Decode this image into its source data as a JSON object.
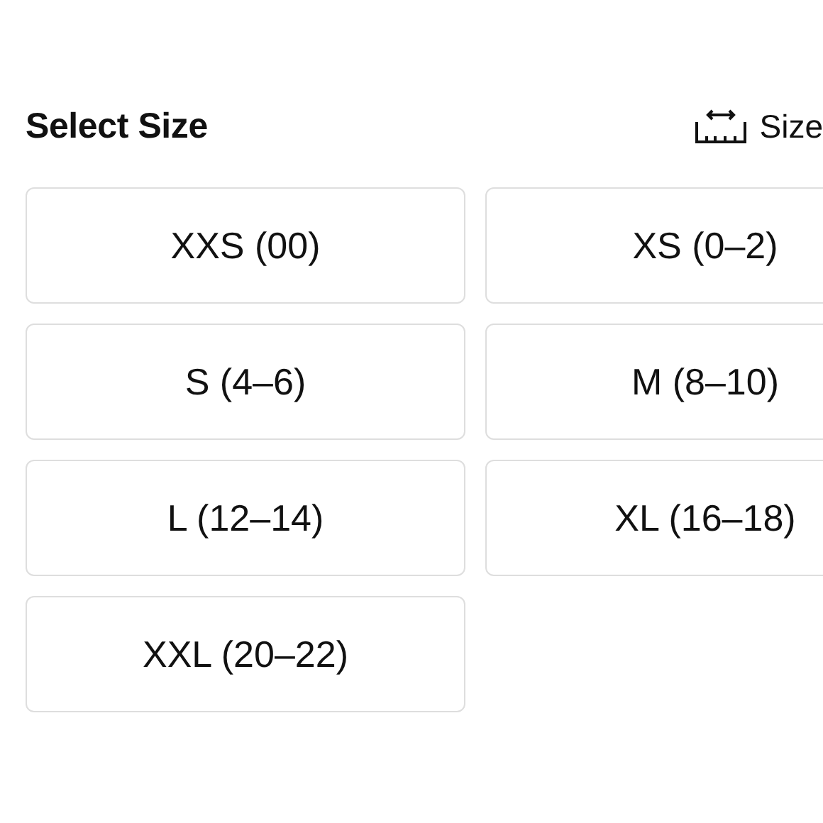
{
  "title": "Select Size",
  "size_guide": {
    "label": "Size"
  },
  "sizes": [
    {
      "label": "XXS (00)"
    },
    {
      "label": "XS (0–2)"
    },
    {
      "label": "S (4–6)"
    },
    {
      "label": "M (8–10)"
    },
    {
      "label": "L (12–14)"
    },
    {
      "label": "XL (16–18)"
    },
    {
      "label": "XXL (20–22)"
    }
  ]
}
